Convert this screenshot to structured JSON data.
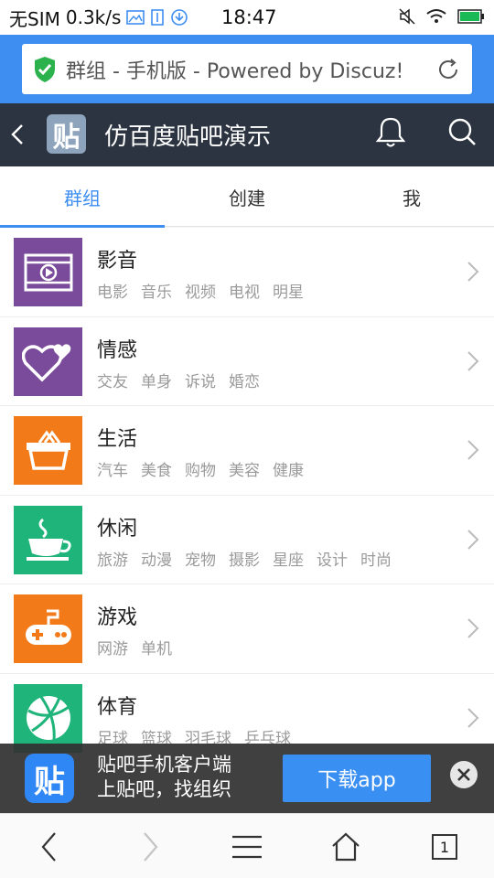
{
  "status_bar": {
    "carrier": "无SIM",
    "speed": "0.3k/s",
    "time": "18:47"
  },
  "browser": {
    "url_text": "群组 - 手机版 - Powered by Discuz!"
  },
  "header": {
    "logo_glyph": "贴",
    "title": "仿百度贴吧演示"
  },
  "tabs": [
    {
      "label": "群组",
      "active": true
    },
    {
      "label": "创建",
      "active": false
    },
    {
      "label": "我",
      "active": false
    }
  ],
  "groups": [
    {
      "title": "影音",
      "tags": [
        "电影",
        "音乐",
        "视频",
        "电视",
        "明星"
      ],
      "icon": "film-icon",
      "color": "#7a4b9a"
    },
    {
      "title": "情感",
      "tags": [
        "交友",
        "单身",
        "诉说",
        "婚恋"
      ],
      "icon": "hearts-icon",
      "color": "#7a4b9a"
    },
    {
      "title": "生活",
      "tags": [
        "汽车",
        "美食",
        "购物",
        "美容",
        "健康"
      ],
      "icon": "basket-icon",
      "color": "#f27a19"
    },
    {
      "title": "休闲",
      "tags": [
        "旅游",
        "动漫",
        "宠物",
        "摄影",
        "星座",
        "设计",
        "时尚"
      ],
      "icon": "coffee-cup-icon",
      "color": "#1fb47a"
    },
    {
      "title": "游戏",
      "tags": [
        "网游",
        "单机"
      ],
      "icon": "gamepad-icon",
      "color": "#f27a19"
    },
    {
      "title": "体育",
      "tags": [
        "足球",
        "篮球",
        "羽毛球",
        "乒乓球"
      ],
      "icon": "basketball-icon",
      "color": "#1fb47a"
    }
  ],
  "banner": {
    "logo_glyph": "贴",
    "line1": "贴吧手机客户端",
    "line2": "上贴吧，找组织",
    "download_label": "下载app"
  },
  "bottom_nav": {
    "tab_count": "1"
  }
}
